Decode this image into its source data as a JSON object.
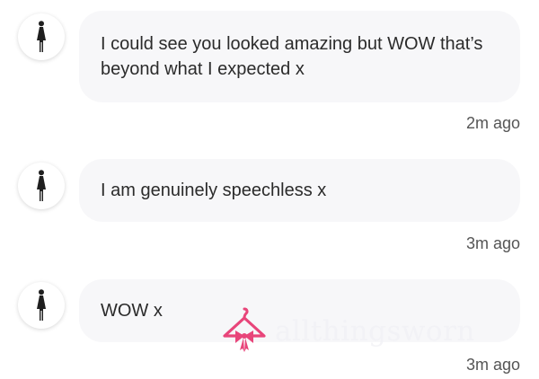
{
  "messages": [
    {
      "avatar_icon": "woman-figure-icon",
      "text": "I could see you looked amazing but WOW that’s beyond what I expected x",
      "time": "2m ago"
    },
    {
      "avatar_icon": "woman-figure-icon",
      "text": "I am genuinely speechless x",
      "time": "3m ago"
    },
    {
      "avatar_icon": "woman-figure-icon",
      "text": "WOW x",
      "time": "3m ago"
    }
  ],
  "watermark": {
    "icon": "hanger-bow-logo-icon",
    "text": "allthingsworn",
    "color": "#e8457a"
  },
  "colors": {
    "bubble_background": "#f7f7f9",
    "text": "#2b2b2b",
    "timestamp": "#555555"
  }
}
